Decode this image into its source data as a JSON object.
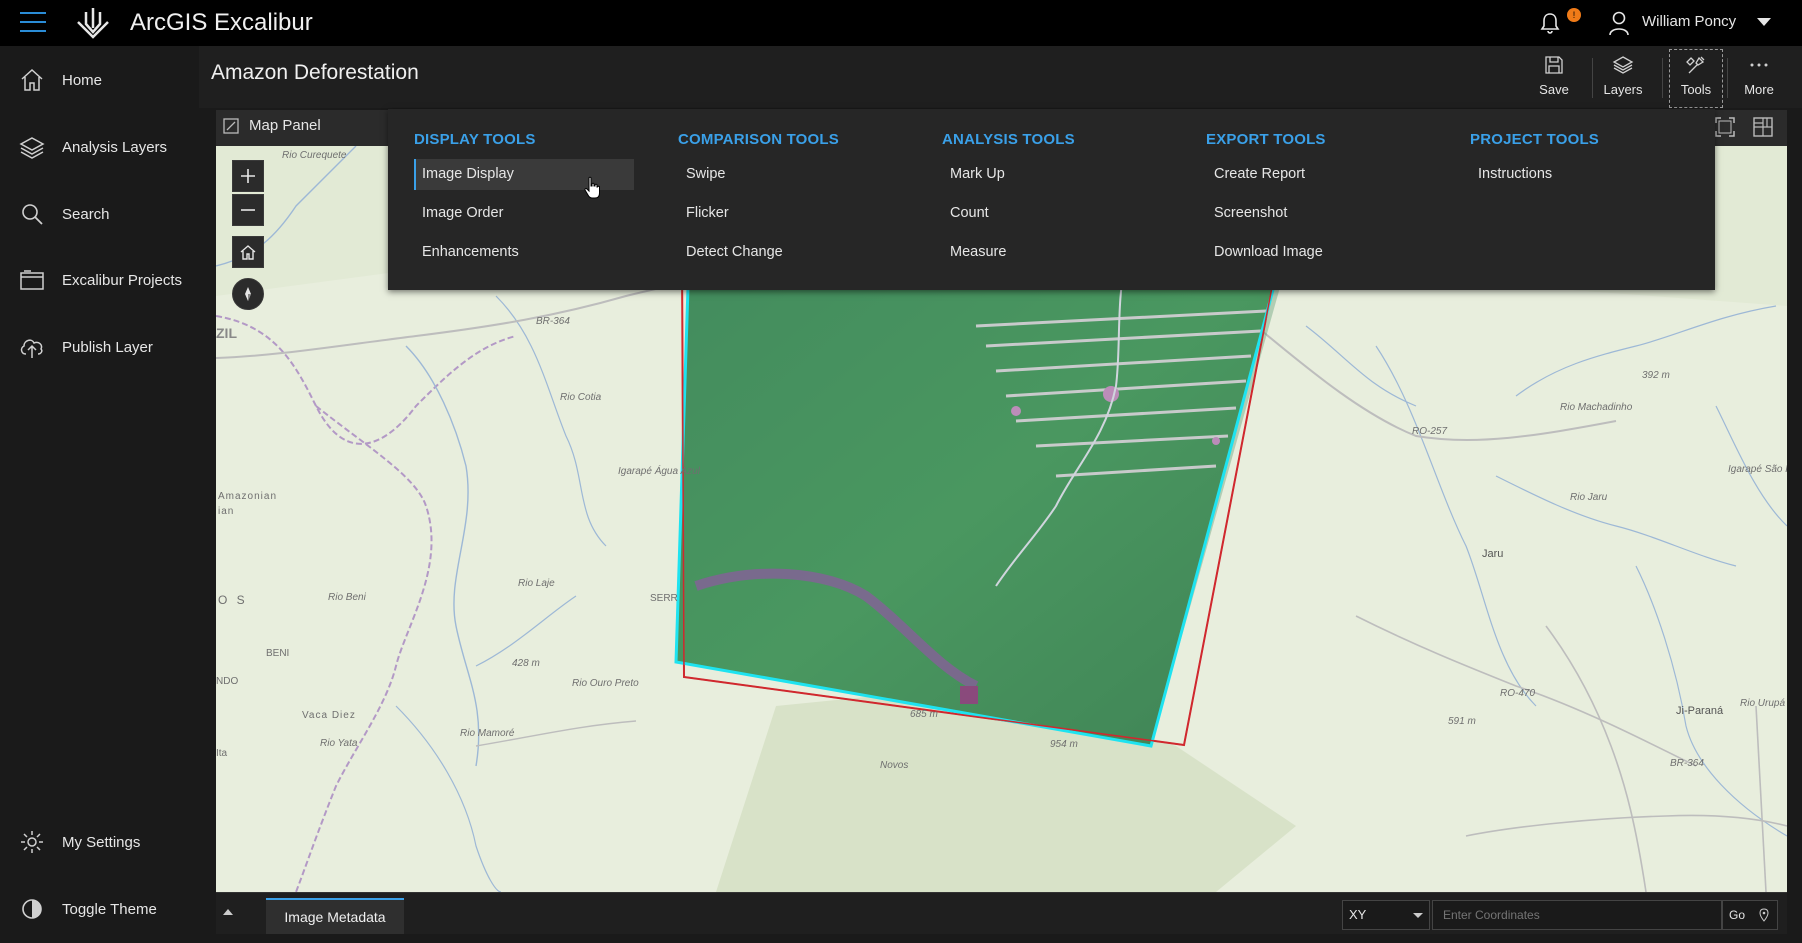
{
  "app": {
    "title": "ArcGIS Excalibur",
    "notification_count": "!"
  },
  "user": {
    "name": "William Poncy"
  },
  "sidebar": {
    "items": [
      {
        "label": "Home",
        "icon": "home-icon"
      },
      {
        "label": "Analysis Layers",
        "icon": "layers-icon"
      },
      {
        "label": "Search",
        "icon": "search-icon"
      },
      {
        "label": "Excalibur Projects",
        "icon": "folder-icon"
      },
      {
        "label": "Publish Layer",
        "icon": "upload-icon"
      }
    ],
    "bottom_items": [
      {
        "label": "My Settings",
        "icon": "gear-icon"
      },
      {
        "label": "Toggle Theme",
        "icon": "contrast-icon"
      }
    ]
  },
  "header": {
    "title": "Amazon Deforestation",
    "buttons": [
      {
        "label": "Save",
        "icon": "save-icon"
      },
      {
        "label": "Layers",
        "icon": "layers-icon"
      },
      {
        "label": "Tools",
        "icon": "tools-icon",
        "active": true
      },
      {
        "label": "More",
        "icon": "more-icon"
      }
    ]
  },
  "map_panel": {
    "title": "Map Panel"
  },
  "tools_menu": {
    "columns": [
      {
        "heading": "DISPLAY TOOLS",
        "items": [
          "Image Display",
          "Image Order",
          "Enhancements"
        ],
        "selected": "Image Display"
      },
      {
        "heading": "COMPARISON TOOLS",
        "items": [
          "Swipe",
          "Flicker",
          "Detect Change"
        ]
      },
      {
        "heading": "ANALYSIS TOOLS",
        "items": [
          "Mark Up",
          "Count",
          "Measure"
        ]
      },
      {
        "heading": "EXPORT TOOLS",
        "items": [
          "Create Report",
          "Screenshot",
          "Download Image"
        ]
      },
      {
        "heading": "PROJECT TOOLS",
        "items": [
          "Instructions"
        ]
      }
    ]
  },
  "map_labels": {
    "rio_curequete": "Rio Curequete",
    "br364": "BR-364",
    "zil": "ZIL",
    "rio_cotia": "Rio Cotia",
    "amazonian": "Amazonian",
    "amazonian2": "ian",
    "igarape": "Igarapé Água Azul",
    "rio_laje": "Rio Laje",
    "rio_beni": "Rio Beni",
    "os": "O S",
    "serra": "SERR",
    "beni": "BENI",
    "ndo": "NDO",
    "m428": "428 m",
    "rio_ouro_preto": "Rio Ouro Preto",
    "vaca_diez": "Vaca Diez",
    "rio_yata": "Rio Yata",
    "rio_mamore": "Rio Mamoré",
    "ita": "Ita",
    "m685": "685 m",
    "m954": "954 m",
    "novos": "Novos",
    "m392": "392 m",
    "rio_machadinho": "Rio Machadinho",
    "ro257": "RO-257",
    "igarape_sao_pedro": "Igarapé São Pedro",
    "rio_jaru": "Rio Jaru",
    "jaru": "Jaru",
    "ro470": "RO-470",
    "m591": "591 m",
    "ji_parana": "Ji-Paraná",
    "br364b": "BR-364",
    "rio_urupa": "Rio Urupá"
  },
  "bottom": {
    "tab": "Image Metadata",
    "coord_system": "XY",
    "coord_placeholder": "Enter Coordinates",
    "go_label": "Go"
  },
  "colors": {
    "accent": "#3aa0e8",
    "badge": "#f07b18",
    "footprint_cyan": "#1ee3f0",
    "footprint_red": "#d0282e"
  }
}
